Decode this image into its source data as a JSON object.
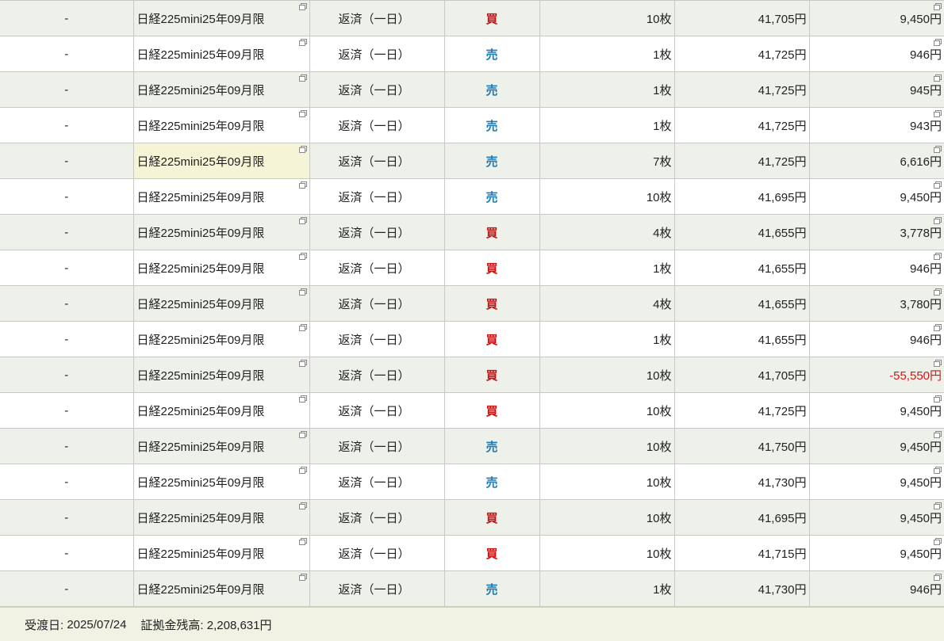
{
  "trades": [
    {
      "dash": "-",
      "name": "日経225mini25年09月限",
      "type": "返済（一日）",
      "side": "買",
      "side_kind": "buy",
      "qty": "10枚",
      "price": "41,705円",
      "pl": "9,450円"
    },
    {
      "dash": "-",
      "name": "日経225mini25年09月限",
      "type": "返済（一日）",
      "side": "売",
      "side_kind": "sell",
      "qty": "1枚",
      "price": "41,725円",
      "pl": "946円"
    },
    {
      "dash": "-",
      "name": "日経225mini25年09月限",
      "type": "返済（一日）",
      "side": "売",
      "side_kind": "sell",
      "qty": "1枚",
      "price": "41,725円",
      "pl": "945円"
    },
    {
      "dash": "-",
      "name": "日経225mini25年09月限",
      "type": "返済（一日）",
      "side": "売",
      "side_kind": "sell",
      "qty": "1枚",
      "price": "41,725円",
      "pl": "943円"
    },
    {
      "dash": "-",
      "name": "日経225mini25年09月限",
      "type": "返済（一日）",
      "side": "売",
      "side_kind": "sell",
      "qty": "7枚",
      "price": "41,725円",
      "pl": "6,616円",
      "highlight": true
    },
    {
      "dash": "-",
      "name": "日経225mini25年09月限",
      "type": "返済（一日）",
      "side": "売",
      "side_kind": "sell",
      "qty": "10枚",
      "price": "41,695円",
      "pl": "9,450円"
    },
    {
      "dash": "-",
      "name": "日経225mini25年09月限",
      "type": "返済（一日）",
      "side": "買",
      "side_kind": "buy",
      "qty": "4枚",
      "price": "41,655円",
      "pl": "3,778円"
    },
    {
      "dash": "-",
      "name": "日経225mini25年09月限",
      "type": "返済（一日）",
      "side": "買",
      "side_kind": "buy",
      "qty": "1枚",
      "price": "41,655円",
      "pl": "946円"
    },
    {
      "dash": "-",
      "name": "日経225mini25年09月限",
      "type": "返済（一日）",
      "side": "買",
      "side_kind": "buy",
      "qty": "4枚",
      "price": "41,655円",
      "pl": "3,780円"
    },
    {
      "dash": "-",
      "name": "日経225mini25年09月限",
      "type": "返済（一日）",
      "side": "買",
      "side_kind": "buy",
      "qty": "1枚",
      "price": "41,655円",
      "pl": "946円"
    },
    {
      "dash": "-",
      "name": "日経225mini25年09月限",
      "type": "返済（一日）",
      "side": "買",
      "side_kind": "buy",
      "qty": "10枚",
      "price": "41,705円",
      "pl": "-55,550円",
      "negative": true
    },
    {
      "dash": "-",
      "name": "日経225mini25年09月限",
      "type": "返済（一日）",
      "side": "買",
      "side_kind": "buy",
      "qty": "10枚",
      "price": "41,725円",
      "pl": "9,450円"
    },
    {
      "dash": "-",
      "name": "日経225mini25年09月限",
      "type": "返済（一日）",
      "side": "売",
      "side_kind": "sell",
      "qty": "10枚",
      "price": "41,750円",
      "pl": "9,450円"
    },
    {
      "dash": "-",
      "name": "日経225mini25年09月限",
      "type": "返済（一日）",
      "side": "売",
      "side_kind": "sell",
      "qty": "10枚",
      "price": "41,730円",
      "pl": "9,450円"
    },
    {
      "dash": "-",
      "name": "日経225mini25年09月限",
      "type": "返済（一日）",
      "side": "買",
      "side_kind": "buy",
      "qty": "10枚",
      "price": "41,695円",
      "pl": "9,450円"
    },
    {
      "dash": "-",
      "name": "日経225mini25年09月限",
      "type": "返済（一日）",
      "side": "買",
      "side_kind": "buy",
      "qty": "10枚",
      "price": "41,715円",
      "pl": "9,450円"
    },
    {
      "dash": "-",
      "name": "日経225mini25年09月限",
      "type": "返済（一日）",
      "side": "売",
      "side_kind": "sell",
      "qty": "1枚",
      "price": "41,730円",
      "pl": "946円"
    }
  ],
  "footer": {
    "settlement_label": "受渡日:",
    "settlement_date": "2025/07/24",
    "margin_label": "証拠金残高:",
    "margin_balance": "2,208,631円"
  },
  "colors": {
    "buy": "#cc1111",
    "sell": "#1a7bb8",
    "negative": "#dd1111",
    "row_alt": "#eef1ea",
    "row_highlight": "#f6f4d6",
    "footer_bg": "#f1f2e4"
  },
  "icons": {
    "detail_popup": "popup-window-icon"
  }
}
